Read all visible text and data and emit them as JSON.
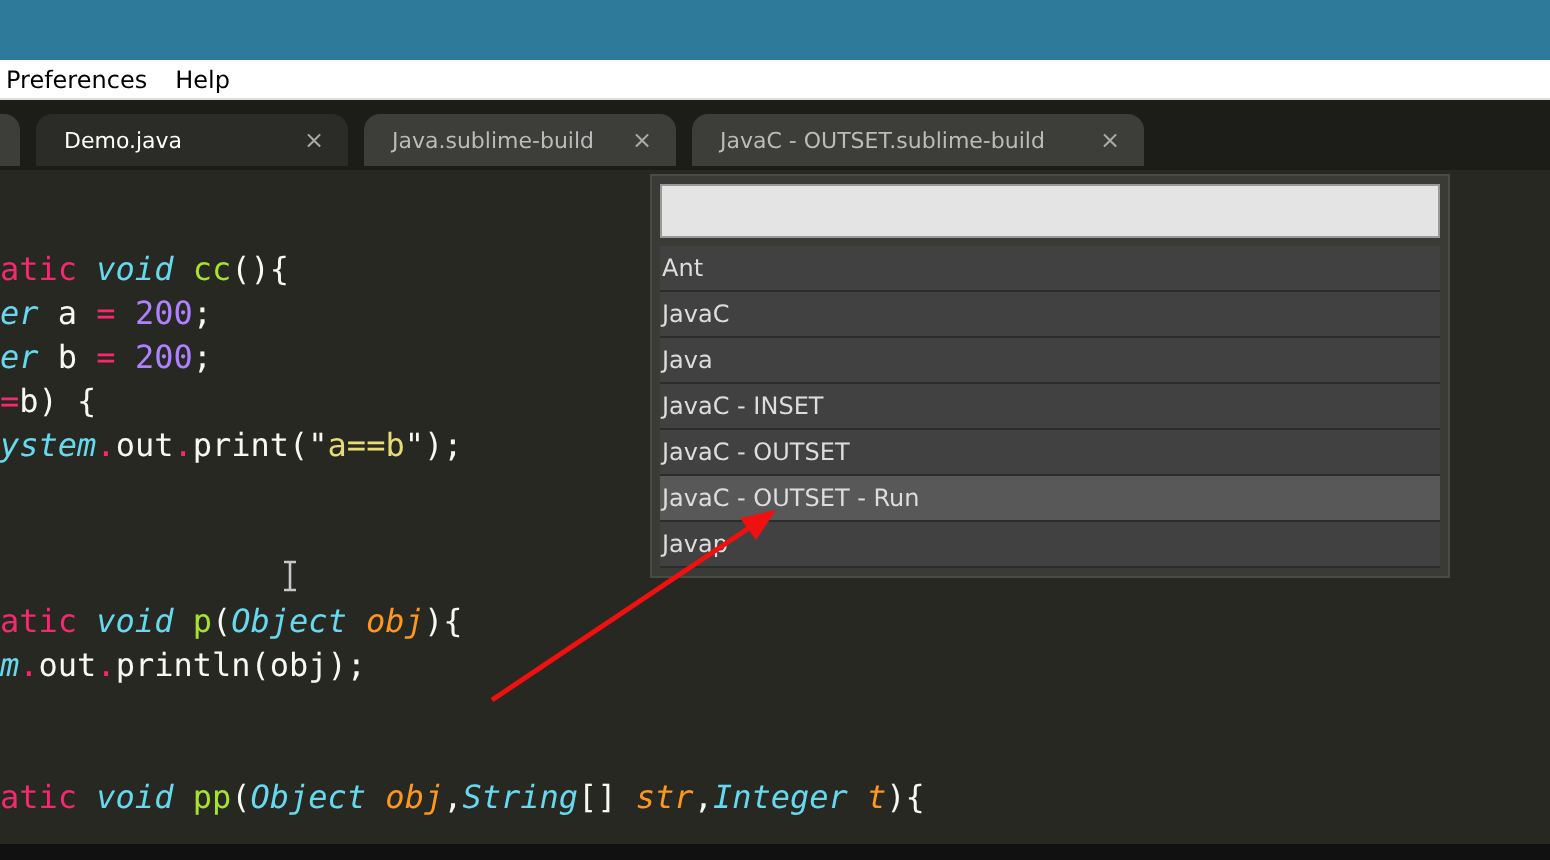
{
  "menu": [
    {
      "label": "Preferences"
    },
    {
      "label": "Help"
    }
  ],
  "tabs": [
    {
      "selected": false
    },
    {
      "label": "Demo.java",
      "selected": true,
      "close": "×"
    },
    {
      "label": "Java.sublime-build",
      "selected": false,
      "close": "×"
    },
    {
      "label": "JavaC - OUTSET.sublime-build",
      "selected": false,
      "close": "×"
    }
  ],
  "code_lines": [
    {
      "kind": "code",
      "tokens": [
        {
          "kind": "keyword",
          "text": "atic"
        },
        {
          "kind": "type",
          "text": " void"
        },
        {
          "kind": "func",
          "text": " cc"
        },
        {
          "kind": "plain",
          "text": "(){"
        }
      ]
    },
    {
      "kind": "code",
      "tokens": [
        {
          "kind": "type",
          "text": "er"
        },
        {
          "kind": "plain",
          "text": " a "
        },
        {
          "kind": "keyword",
          "text": "="
        },
        {
          "kind": "number",
          "text": " 200"
        },
        {
          "kind": "plain",
          "text": ";"
        }
      ]
    },
    {
      "kind": "code",
      "tokens": [
        {
          "kind": "type",
          "text": "er"
        },
        {
          "kind": "plain",
          "text": " b "
        },
        {
          "kind": "keyword",
          "text": "="
        },
        {
          "kind": "number",
          "text": " 200"
        },
        {
          "kind": "plain",
          "text": ";"
        }
      ]
    },
    {
      "kind": "code",
      "tokens": [
        {
          "kind": "keyword",
          "text": "="
        },
        {
          "kind": "plain",
          "text": "b) {"
        }
      ]
    },
    {
      "kind": "code",
      "tokens": [
        {
          "kind": "type",
          "text": "ystem"
        },
        {
          "kind": "keyword",
          "text": "."
        },
        {
          "kind": "plain",
          "text": "out"
        },
        {
          "kind": "keyword",
          "text": "."
        },
        {
          "kind": "plain",
          "text": "print(\""
        },
        {
          "kind": "string",
          "text": "a==b"
        },
        {
          "kind": "plain",
          "text": "\");"
        }
      ]
    },
    {
      "kind": "blank"
    },
    {
      "kind": "blank"
    },
    {
      "kind": "blank"
    },
    {
      "kind": "code",
      "tokens": [
        {
          "kind": "keyword",
          "text": "atic"
        },
        {
          "kind": "type",
          "text": " void"
        },
        {
          "kind": "func",
          "text": " p"
        },
        {
          "kind": "plain",
          "text": "("
        },
        {
          "kind": "type",
          "text": "Object"
        },
        {
          "kind": "param",
          "text": " obj"
        },
        {
          "kind": "plain",
          "text": "){"
        }
      ]
    },
    {
      "kind": "code",
      "tokens": [
        {
          "kind": "type",
          "text": "m"
        },
        {
          "kind": "keyword",
          "text": "."
        },
        {
          "kind": "plain",
          "text": "out"
        },
        {
          "kind": "keyword",
          "text": "."
        },
        {
          "kind": "plain",
          "text": "println(obj);"
        }
      ]
    },
    {
      "kind": "blank"
    },
    {
      "kind": "blank"
    },
    {
      "kind": "code",
      "tokens": [
        {
          "kind": "keyword",
          "text": "atic"
        },
        {
          "kind": "type",
          "text": " void"
        },
        {
          "kind": "func",
          "text": " pp"
        },
        {
          "kind": "plain",
          "text": "("
        },
        {
          "kind": "type",
          "text": "Object"
        },
        {
          "kind": "param",
          "text": " obj"
        },
        {
          "kind": "plain",
          "text": ","
        },
        {
          "kind": "type",
          "text": "String"
        },
        {
          "kind": "plain",
          "text": "[]"
        },
        {
          "kind": "param",
          "text": " str"
        },
        {
          "kind": "plain",
          "text": ","
        },
        {
          "kind": "type",
          "text": "Integer"
        },
        {
          "kind": "param",
          "text": " t"
        },
        {
          "kind": "plain",
          "text": "){"
        }
      ]
    }
  ],
  "build_menu": {
    "items": [
      {
        "label": "Ant",
        "selected": false
      },
      {
        "label": "JavaC",
        "selected": false
      },
      {
        "label": "Java",
        "selected": false
      },
      {
        "label": "JavaC - INSET",
        "selected": false
      },
      {
        "label": "JavaC - OUTSET",
        "selected": false
      },
      {
        "label": "JavaC - OUTSET - Run",
        "selected": true
      },
      {
        "label": "Javap",
        "selected": false
      }
    ]
  }
}
